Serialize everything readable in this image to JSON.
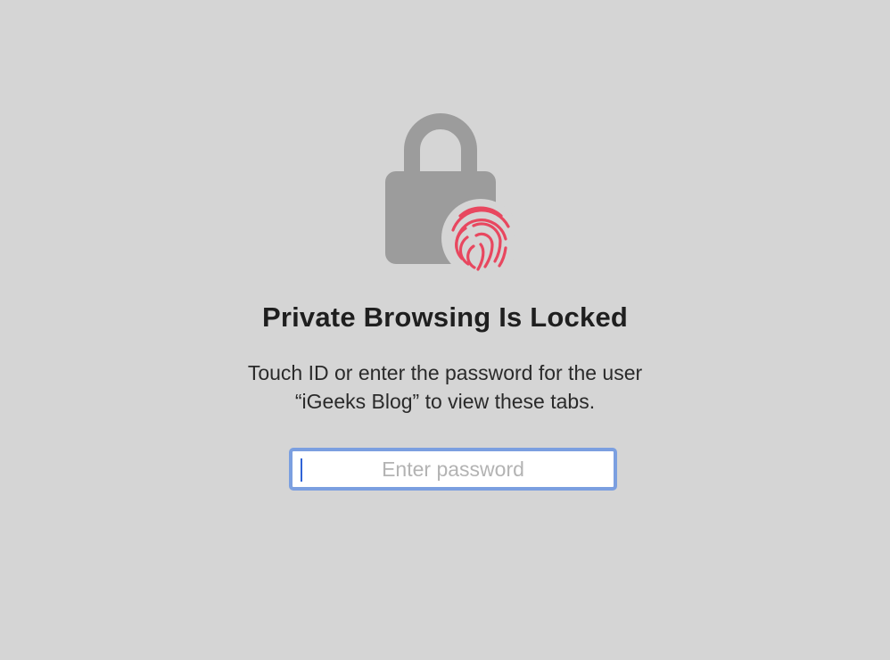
{
  "lock_screen": {
    "title": "Private Browsing Is Locked",
    "message_line1": "Touch ID or enter the password for the user",
    "message_line2": "“iGeeks Blog” to view these tabs.",
    "password_placeholder": "Enter password",
    "password_value": ""
  },
  "icons": {
    "lock": "lock-icon",
    "fingerprint": "fingerprint-icon"
  },
  "colors": {
    "background": "#d5d5d5",
    "lock_gray": "#9c9c9c",
    "fingerprint_red": "#e8475f",
    "focus_ring": "#7b9fe0"
  }
}
